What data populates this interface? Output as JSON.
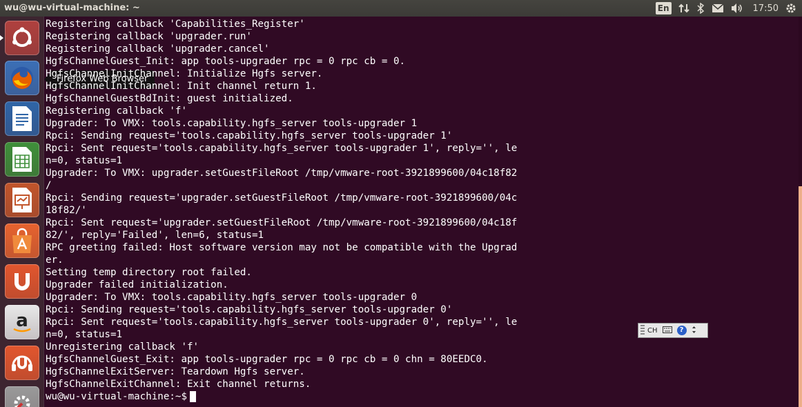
{
  "topbar": {
    "window_title": "wu@wu-virtual-machine: ~",
    "keyboard_layout": "En",
    "clock": "17:50"
  },
  "launcher": {
    "items": [
      {
        "name": "dash-home",
        "icon": "ubuntu-logo-icon",
        "color": "#b0413e"
      },
      {
        "name": "firefox",
        "icon": "firefox-icon",
        "color": "#3b6fb6"
      },
      {
        "name": "libreoffice-writer",
        "icon": "writer-document-icon",
        "color": "#2f65a7"
      },
      {
        "name": "libreoffice-calc",
        "icon": "calc-spreadsheet-icon",
        "color": "#3f8f3a"
      },
      {
        "name": "libreoffice-impress",
        "icon": "impress-presentation-icon",
        "color": "#c2552b"
      },
      {
        "name": "ubuntu-software-center",
        "icon": "software-center-bag-icon",
        "color": "#e7632f"
      },
      {
        "name": "ubuntu-one",
        "icon": "ubuntu-one-icon",
        "color": "#e2562e"
      },
      {
        "name": "amazon",
        "icon": "amazon-icon",
        "color": "#e8e8e8"
      },
      {
        "name": "ubuntu-one-music",
        "icon": "music-headphones-icon",
        "color": "#e2562e"
      },
      {
        "name": "system-settings",
        "icon": "settings-wrench-icon",
        "color": "#9a9a9a"
      }
    ],
    "tooltip": "Firefox Web Browser"
  },
  "terminal": {
    "lines": [
      "Registering callback 'Capabilities_Register'",
      "Registering callback 'upgrader.run'",
      "Registering callback 'upgrader.cancel'",
      "HgfsChannelGuest_Init: app tools-upgrader rpc = 0 rpc cb = 0.",
      "HgfsChannelInitChannel: Initialize Hgfs server.",
      "HgfsChannelInitChannel: Init channel return 1.",
      "HgfsChannelGuestBdInit: guest initialized.",
      "Registering callback 'f'",
      "Upgrader: To VMX: tools.capability.hgfs_server tools-upgrader 1",
      "Rpci: Sending request='tools.capability.hgfs_server tools-upgrader 1'",
      "Rpci: Sent request='tools.capability.hgfs_server tools-upgrader 1', reply='', le",
      "n=0, status=1",
      "Upgrader: To VMX: upgrader.setGuestFileRoot /tmp/vmware-root-3921899600/04c18f82",
      "/",
      "Rpci: Sending request='upgrader.setGuestFileRoot /tmp/vmware-root-3921899600/04c",
      "18f82/'",
      "Rpci: Sent request='upgrader.setGuestFileRoot /tmp/vmware-root-3921899600/04c18f",
      "82/', reply='Failed', len=6, status=1",
      "RPC greeting failed: Host software version may not be compatible with the Upgrad",
      "er.",
      "Setting temp directory root failed.",
      "Upgrader failed initialization.",
      "Upgrader: To VMX: tools.capability.hgfs_server tools-upgrader 0",
      "Rpci: Sending request='tools.capability.hgfs_server tools-upgrader 0'",
      "Rpci: Sent request='tools.capability.hgfs_server tools-upgrader 0', reply='', le",
      "n=0, status=1",
      "Unregistering callback 'f'",
      "HgfsChannelGuest_Exit: app tools-upgrader rpc = 0 rpc cb = 0 chn = 80EEDC0.",
      "HgfsChannelExitServer: Teardown Hgfs server.",
      "HgfsChannelExitChannel: Exit channel returns."
    ],
    "prompt": "wu@wu-virtual-machine:~$"
  },
  "ime_bar": {
    "mode": "CH"
  }
}
